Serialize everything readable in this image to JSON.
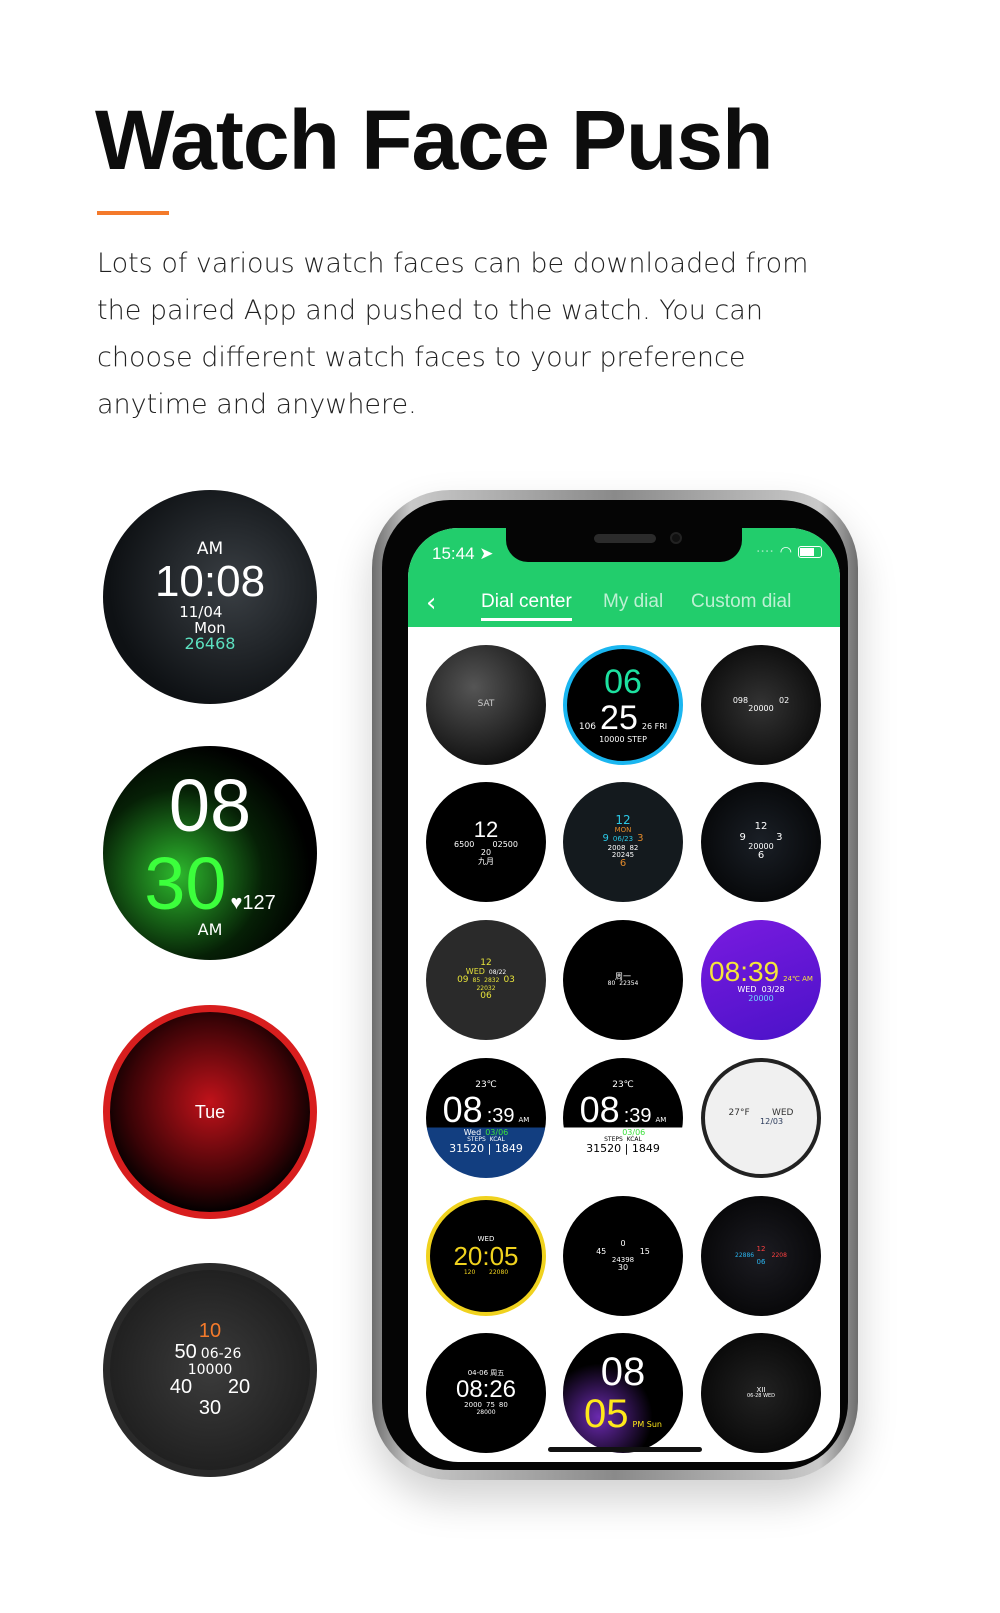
{
  "heading": {
    "title": "Watch Face Push",
    "accent_color": "#f47a2b",
    "description": "Lots of various watch faces can be downloaded from the paired App and pushed to the watch. You can choose different watch faces to your preference anytime and anywhere."
  },
  "showcase_faces": [
    {
      "bg": "radial-gradient(circle at 60% 45%,#3a3f44,#0e1114 70%)",
      "lines": [
        [
          {
            "t": "AM",
            "s": 17
          }
        ],
        [
          {
            "t": "10:08",
            "s": 44
          }
        ],
        [
          {
            "t": "11/04",
            "s": 15
          },
          {
            "t": "   ",
            "s": 15
          }
        ],
        [
          {
            "t": "Mon",
            "s": 15
          }
        ],
        [
          {
            "t": "26468",
            "s": 16,
            "c": "#5ce0c0"
          }
        ]
      ]
    },
    {
      "bg": "radial-gradient(circle at 35% 60%,#2db82d,#062006 45%,#000 70%)",
      "lines": [
        [
          {
            "t": "08",
            "s": 74
          }
        ],
        [
          {
            "t": "30",
            "s": 74,
            "c": "#3cff3c"
          },
          {
            "t": "♥127",
            "s": 20,
            "c": "#fff"
          }
        ],
        [
          {
            "t": "AM",
            "s": 16
          }
        ]
      ]
    },
    {
      "bg": "radial-gradient(circle at 50% 45%,#c0121a,#3a0306 55%,#000 75%)",
      "ring": "#d81e1e",
      "lines": [
        [
          {
            "t": "",
            "s": 60
          }
        ],
        [
          {
            "t": "Tue",
            "s": 18
          }
        ]
      ]
    },
    {
      "bg": "radial-gradient(circle,#3b3b3b,#1d1d1d 80%)",
      "ring": "#2a2a2a",
      "lines": [
        [
          {
            "t": "10",
            "s": 20,
            "c": "#f47a2b"
          }
        ],
        [
          {
            "t": "50",
            "s": 20
          },
          {
            "t": "06-26",
            "s": 14
          },
          {
            "t": "",
            "s": 20
          }
        ],
        [
          {
            "t": "10000",
            "s": 14
          }
        ],
        [
          {
            "t": "40",
            "s": 20
          },
          {
            "t": "     ",
            "s": 20
          },
          {
            "t": "20",
            "s": 20
          }
        ],
        [
          {
            "t": "30",
            "s": 20
          }
        ]
      ]
    }
  ],
  "phone": {
    "status_time": "15:44",
    "status_icons": [
      "location-arrow-icon",
      "wifi-icon",
      "battery-icon"
    ],
    "tabs": [
      {
        "label": "Dial center",
        "active": true
      },
      {
        "label": "My dial",
        "active": false
      },
      {
        "label": "Custom dial",
        "active": false
      }
    ],
    "header_color": "#22cd6c",
    "dials": [
      {
        "bg": "radial-gradient(circle at 40% 35%,#555,#111 75%)",
        "lines": [
          [
            {
              "t": "SAT",
              "s": 9,
              "c": "#ccc"
            }
          ],
          [
            {
              "t": "",
              "s": 40
            }
          ]
        ]
      },
      {
        "bg": "#000",
        "ring": "#1ab6f0",
        "lines": [
          [
            {
              "t": "06",
              "s": 34,
              "c": "#1de2a0"
            }
          ],
          [
            {
              "t": "106",
              "s": 9
            },
            {
              "t": "25",
              "s": 34
            },
            {
              "t": "26 FRI",
              "s": 8
            }
          ],
          [
            {
              "t": "10000 STEP",
              "s": 8
            }
          ]
        ]
      },
      {
        "bg": "radial-gradient(circle,#333,#000)",
        "lines": [
          [
            {
              "t": "",
              "s": 18
            }
          ],
          [
            {
              "t": "098",
              "s": 8
            },
            {
              "t": "         ",
              "s": 8
            },
            {
              "t": "02",
              "s": 8
            }
          ],
          [
            {
              "t": "20000",
              "s": 8
            }
          ]
        ]
      },
      {
        "bg": "#000",
        "lines": [
          [
            {
              "t": "12",
              "s": 22
            }
          ],
          [
            {
              "t": "6500",
              "s": 8
            },
            {
              "t": "    ",
              "s": 8
            },
            {
              "t": "02500",
              "s": 8
            }
          ],
          [
            {
              "t": "20",
              "s": 8
            }
          ],
          [
            {
              "t": "九月",
              "s": 8
            }
          ]
        ]
      },
      {
        "bg": "#141a1e",
        "lines": [
          [
            {
              "t": "12",
              "s": 12,
              "c": "#2bc8e6"
            }
          ],
          [
            {
              "t": "MON",
              "s": 7,
              "c": "#e28a2b"
            }
          ],
          [
            {
              "t": "9",
              "s": 10,
              "c": "#2bc8e6"
            },
            {
              "t": "06/23",
              "s": 7,
              "c": "#2bc8e6"
            },
            {
              "t": "3",
              "s": 10,
              "c": "#e28a2b"
            }
          ],
          [
            {
              "t": "2008",
              "s": 7
            },
            {
              "t": "82",
              "s": 7
            }
          ],
          [
            {
              "t": "20245",
              "s": 7
            }
          ],
          [
            {
              "t": "6",
              "s": 10,
              "c": "#e28a2b"
            }
          ]
        ]
      },
      {
        "bg": "radial-gradient(circle,#1a1f26,#000)",
        "lines": [
          [
            {
              "t": "12",
              "s": 10
            }
          ],
          [
            {
              "t": "9",
              "s": 10
            },
            {
              "t": "       ",
              "s": 10
            },
            {
              "t": "3",
              "s": 10
            }
          ],
          [
            {
              "t": "20000",
              "s": 8
            }
          ],
          [
            {
              "t": "6",
              "s": 10
            }
          ]
        ]
      },
      {
        "bg": "#2a2a2a",
        "lines": [
          [
            {
              "t": "12",
              "s": 9,
              "c": "#e6e23a"
            }
          ],
          [
            {
              "t": "WED",
              "s": 8,
              "c": "#e6e23a"
            },
            {
              "t": "08/22",
              "s": 6
            }
          ],
          [
            {
              "t": "09",
              "s": 9,
              "c": "#e6e23a"
            },
            {
              "t": "85",
              "s": 6,
              "c": "#e6e23a"
            },
            {
              "t": "2832",
              "s": 6,
              "c": "#e6e23a"
            },
            {
              "t": "03",
              "s": 9,
              "c": "#e6e23a"
            }
          ],
          [
            {
              "t": "22032",
              "s": 6,
              "c": "#e6e23a"
            }
          ],
          [
            {
              "t": "06",
              "s": 9,
              "c": "#e6e23a"
            }
          ]
        ]
      },
      {
        "bg": "#000",
        "lines": [
          [
            {
              "t": "周一",
              "s": 8
            }
          ],
          [
            {
              "t": "",
              "s": 30
            }
          ],
          [
            {
              "t": "80",
              "s": 6
            },
            {
              "t": "22354",
              "s": 6
            }
          ]
        ]
      },
      {
        "bg": "linear-gradient(160deg,#7a1be0,#4a12c8)",
        "lines": [
          [
            {
              "t": "08:39",
              "s": 28,
              "c": "#f5e63a"
            },
            {
              "t": "24℃ AM",
              "s": 7,
              "c": "#f5e63a"
            }
          ],
          [
            {
              "t": "WED  03/28",
              "s": 8
            }
          ],
          [
            {
              "t": "20000",
              "s": 8,
              "c": "#6fd6ff"
            }
          ]
        ]
      },
      {
        "bg": "linear-gradient(#000 58%,#123e80 58%)",
        "lines": [
          [
            {
              "t": "23℃",
              "s": 9
            }
          ],
          [
            {
              "t": "08",
              "s": 36
            },
            {
              "t": ":39",
              "s": 20
            },
            {
              "t": "AM",
              "s": 7
            }
          ],
          [
            {
              "t": "Wed",
              "s": 8
            },
            {
              "t": "03/06",
              "s": 8,
              "c": "#3ce03c"
            }
          ],
          [
            {
              "t": "STEPS  KCAL",
              "s": 6
            }
          ],
          [
            {
              "t": "31520 | 1849",
              "s": 11
            }
          ]
        ]
      },
      {
        "bg": "linear-gradient(#000 58%,#fff 58%)",
        "lines": [
          [
            {
              "t": "23℃",
              "s": 9
            }
          ],
          [
            {
              "t": "08",
              "s": 36
            },
            {
              "t": ":39",
              "s": 20
            },
            {
              "t": "AM",
              "s": 7
            }
          ],
          [
            {
              "t": "Wed",
              "s": 8
            },
            {
              "t": "03/06",
              "s": 8,
              "c": "#3ce03c"
            }
          ],
          [
            {
              "t": "STEPS  KCAL",
              "s": 6,
              "c": "#000"
            }
          ],
          [
            {
              "t": "31520 | 1849",
              "s": 11,
              "c": "#000"
            }
          ]
        ]
      },
      {
        "bg": "#f0f0f0",
        "ring": "#222",
        "lines": [
          [
            {
              "t": "",
              "s": 16
            }
          ],
          [
            {
              "t": "27°F",
              "s": 9,
              "c": "#333"
            },
            {
              "t": "     ",
              "s": 9
            },
            {
              "t": "WED",
              "s": 9,
              "c": "#333"
            }
          ],
          [
            {
              "t": "      ",
              "s": 9
            },
            {
              "t": "12/03",
              "s": 8,
              "c": "#2a3a5a"
            }
          ]
        ]
      },
      {
        "bg": "#000",
        "ring": "#f0d21e",
        "lines": [
          [
            {
              "t": "WED",
              "s": 7
            }
          ],
          [
            {
              "t": "20:05",
              "s": 26,
              "c": "#f0d21e"
            }
          ],
          [
            {
              "t": "120",
              "s": 6,
              "c": "#f0d21e"
            },
            {
              "t": "   ",
              "s": 6
            },
            {
              "t": "22080",
              "s": 6,
              "c": "#f0d21e"
            }
          ]
        ]
      },
      {
        "bg": "#000",
        "lines": [
          [
            {
              "t": "0",
              "s": 8
            }
          ],
          [
            {
              "t": "45",
              "s": 8
            },
            {
              "t": "          ",
              "s": 8
            },
            {
              "t": "15",
              "s": 8
            }
          ],
          [
            {
              "t": "24398",
              "s": 7
            }
          ],
          [
            {
              "t": "30",
              "s": 8
            }
          ]
        ]
      },
      {
        "bg": "radial-gradient(circle,#1c1c22,#000)",
        "lines": [
          [
            {
              "t": "12",
              "s": 7,
              "c": "#ff4040"
            }
          ],
          [
            {
              "t": "22886",
              "s": 6,
              "c": "#2bb5f0"
            },
            {
              "t": "     ",
              "s": 6
            },
            {
              "t": "2208",
              "s": 6,
              "c": "#ff4040"
            }
          ],
          [
            {
              "t": "06",
              "s": 7,
              "c": "#2bb5f0"
            }
          ]
        ]
      },
      {
        "bg": "#000",
        "lines": [
          [
            {
              "t": "04-06 周五",
              "s": 7
            }
          ],
          [
            {
              "t": "08:26",
              "s": 24
            }
          ],
          [
            {
              "t": "2000",
              "s": 7
            },
            {
              "t": "75",
              "s": 7
            },
            {
              "t": "80",
              "s": 7
            }
          ],
          [
            {
              "t": "28000",
              "s": 6
            }
          ]
        ]
      },
      {
        "bg": "radial-gradient(circle at 30% 70%,#6b2ab0,#000 45%),radial-gradient(circle at 70% 80%,#1a6bd0,#000 50%)",
        "lines": [
          [
            {
              "t": "08",
              "s": 40
            }
          ],
          [
            {
              "t": "05",
              "s": 40,
              "c": "#ffe81a"
            },
            {
              "t": "PM Sun",
              "s": 8,
              "c": "#ffe81a"
            }
          ]
        ]
      },
      {
        "bg": "radial-gradient(circle,#222,#000)",
        "lines": [
          [
            {
              "t": "XII",
              "s": 7
            }
          ],
          [
            {
              "t": "",
              "s": 30
            }
          ],
          [
            {
              "t": "06-28 WED",
              "s": 5
            }
          ]
        ]
      }
    ]
  }
}
